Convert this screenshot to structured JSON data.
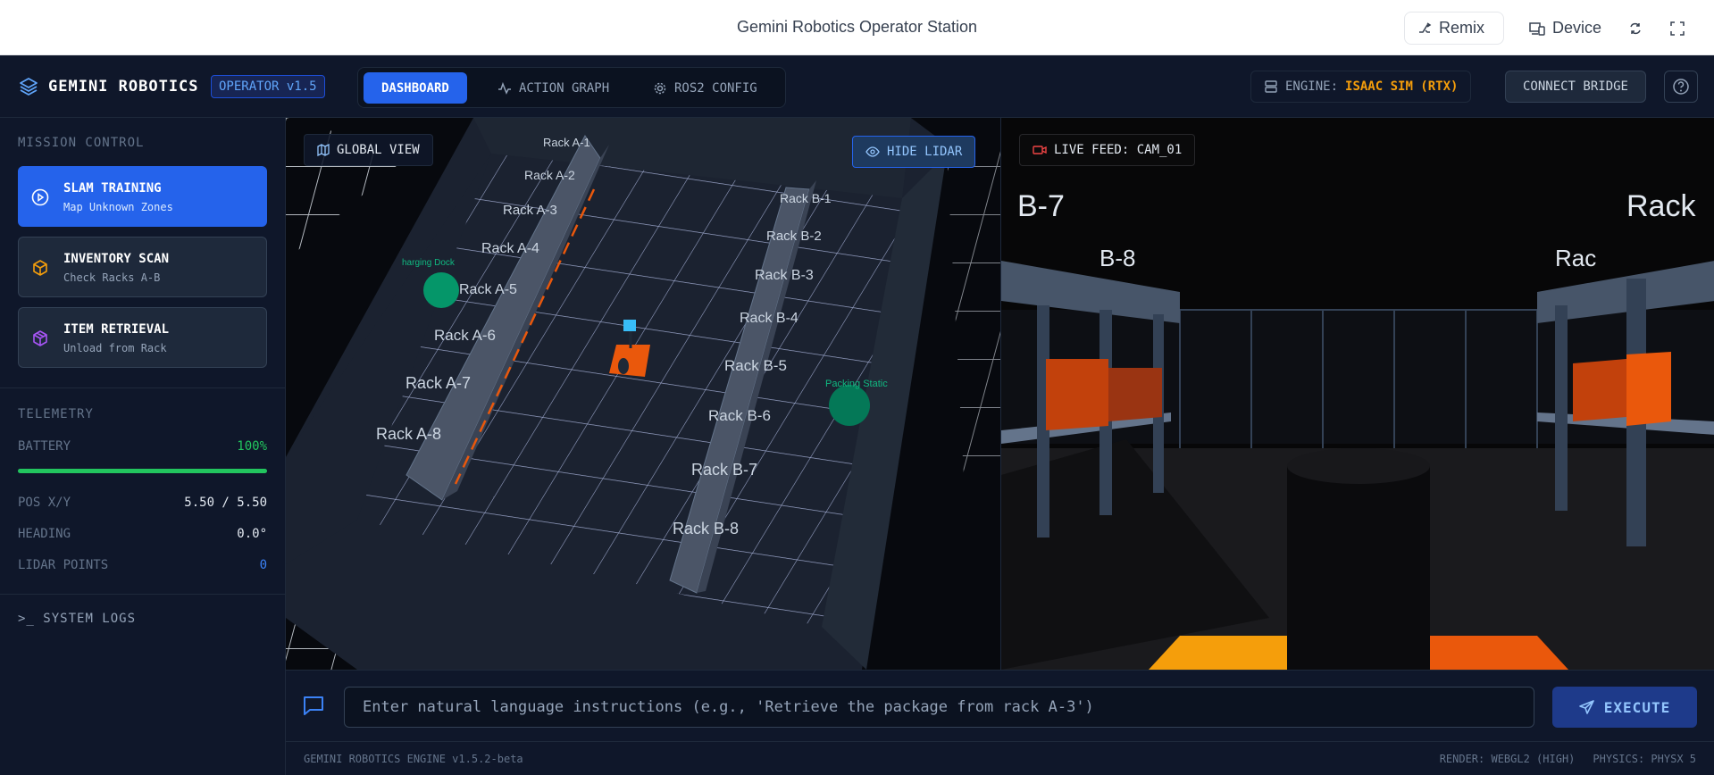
{
  "topbar": {
    "title": "Gemini Robotics Operator Station",
    "remix": "Remix",
    "device": "Device"
  },
  "app": {
    "brand": "GEMINI ROBOTICS",
    "version": "OPERATOR v1.5",
    "tabs": [
      {
        "label": "DASHBOARD"
      },
      {
        "label": "ACTION GRAPH"
      },
      {
        "label": "ROS2 CONFIG"
      }
    ],
    "engine_label": "ENGINE:",
    "engine_value": "ISAAC SIM (RTX)",
    "connect": "CONNECT BRIDGE"
  },
  "sidebar": {
    "mission_title": "MISSION CONTROL",
    "missions": [
      {
        "title": "SLAM TRAINING",
        "subtitle": "Map Unknown Zones",
        "icon": "play-circle-icon"
      },
      {
        "title": "INVENTORY SCAN",
        "subtitle": "Check Racks A-B",
        "icon": "box-icon"
      },
      {
        "title": "ITEM RETRIEVAL",
        "subtitle": "Unload from Rack",
        "icon": "package-icon"
      }
    ],
    "telemetry_title": "TELEMETRY",
    "battery_label": "BATTERY",
    "battery_value": "100%",
    "battery_level": 1.0,
    "pos_label": "POS X/Y",
    "pos_value": "5.50 / 5.50",
    "heading_label": "HEADING",
    "heading_value": "0.0°",
    "lidar_label": "LIDAR POINTS",
    "lidar_value": "0",
    "logs_label": "SYSTEM LOGS"
  },
  "map": {
    "global_view": "GLOBAL VIEW",
    "hide_lidar": "HIDE LIDAR",
    "rack_a": [
      "Rack A-1",
      "Rack A-2",
      "Rack A-3",
      "Rack A-4",
      "Rack A-5",
      "Rack A-6",
      "Rack A-7",
      "Rack A-8"
    ],
    "rack_b": [
      "Rack B-1",
      "Rack B-2",
      "Rack B-3",
      "Rack B-4",
      "Rack B-5",
      "Rack B-6",
      "Rack B-7",
      "Rack B-8"
    ],
    "charging": "harging Dock",
    "packing": "Packing Static"
  },
  "camera": {
    "live_feed": "LIVE FEED: CAM_01",
    "label_b7": "B-7",
    "label_b8": "B-8",
    "label_rack_r": "Rack",
    "label_rack_r2": "Rac"
  },
  "command": {
    "placeholder": "Enter natural language instructions (e.g., 'Retrieve the package from rack A-3')",
    "execute": "EXECUTE"
  },
  "status": {
    "engine": "GEMINI ROBOTICS ENGINE v1.5.2-beta",
    "render": "RENDER: WEBGL2 (HIGH)",
    "physics": "PHYSICS: PHYSX 5"
  },
  "colors": {
    "accent": "#2563eb",
    "battery": "#22c55e",
    "engine": "#f59e0b"
  }
}
